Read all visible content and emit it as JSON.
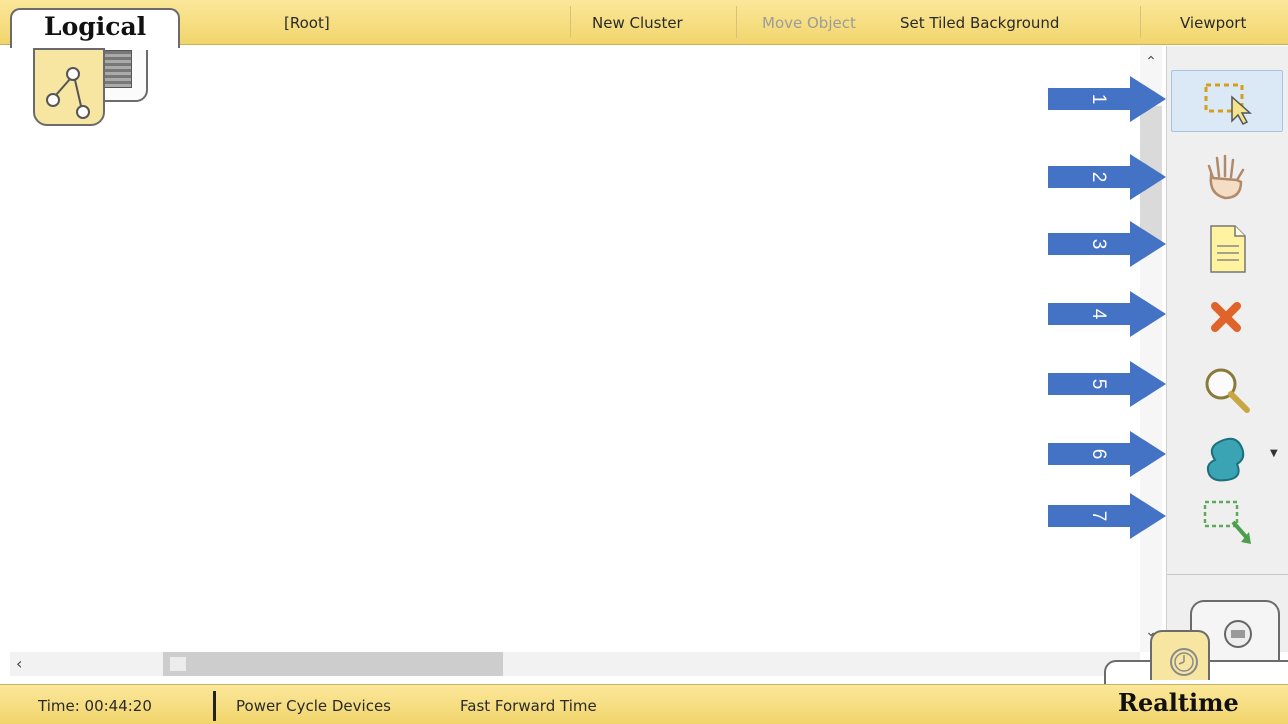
{
  "topbar": {
    "mode_label": "Logical",
    "root_label": "[Root]",
    "new_cluster": "New Cluster",
    "move_object": "Move Object",
    "set_tiled_background": "Set Tiled Background",
    "viewport": "Viewport"
  },
  "toolbar": {
    "tools": [
      {
        "name": "select-icon",
        "callout": "1"
      },
      {
        "name": "hand-icon",
        "callout": "2"
      },
      {
        "name": "note-icon",
        "callout": "3"
      },
      {
        "name": "delete-icon",
        "callout": "4"
      },
      {
        "name": "zoom-icon",
        "callout": "5"
      },
      {
        "name": "shape-icon",
        "callout": "6"
      },
      {
        "name": "resize-icon",
        "callout": "7"
      }
    ],
    "accent_color": "#4472c4"
  },
  "statusbar": {
    "time": "Time: 00:44:20",
    "power_cycle": "Power Cycle Devices",
    "fast_forward": "Fast Forward Time",
    "mode_label": "Realtime"
  },
  "callouts": [
    "1",
    "2",
    "3",
    "4",
    "5",
    "6",
    "7"
  ]
}
